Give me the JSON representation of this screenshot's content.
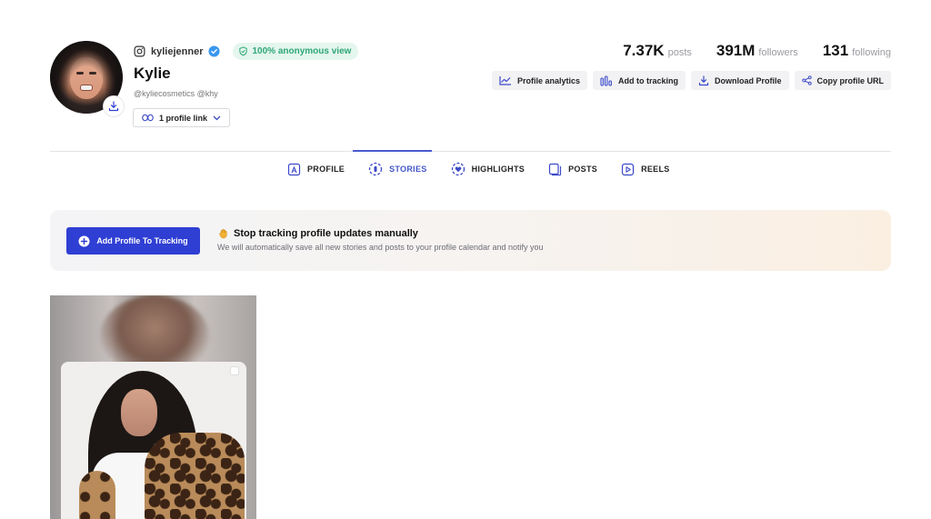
{
  "profile": {
    "handle": "kyliejenner",
    "name": "Kylie",
    "aliases": "@kyliecosmetics @khy",
    "anonymous_badge": "100% anonymous view",
    "profile_link_label": "1 profile link"
  },
  "stats": [
    {
      "value": "7.37K",
      "label": "posts"
    },
    {
      "value": "391M",
      "label": "followers"
    },
    {
      "value": "131",
      "label": "following"
    }
  ],
  "actions": {
    "analytics": "Profile analytics",
    "tracking": "Add to tracking",
    "download": "Download Profile",
    "copy_url": "Copy profile URL"
  },
  "tabs": {
    "profile": "PROFILE",
    "stories": "STORIES",
    "highlights": "HIGHLIGHTS",
    "posts": "POSTS",
    "reels": "REELS",
    "active": "stories"
  },
  "banner": {
    "cta_label": "Add Profile To Tracking",
    "title": "Stop tracking profile updates manually",
    "subtitle": "We will automatically save all new stories and posts to your profile calendar and notify you"
  },
  "colors": {
    "accent": "#2f3fd3",
    "tab_active": "#4356c8",
    "badge_green": "#2fa77a",
    "verified_blue": "#3897f0"
  },
  "icons": {
    "instagram": "instagram-icon",
    "verified": "verified-badge-icon",
    "shield": "shield-check-icon",
    "link": "link-icon",
    "chevron": "chevron-down-icon",
    "download": "download-icon",
    "analytics": "line-chart-icon",
    "tracking": "bar-chart-icon",
    "share": "share-icon",
    "plus": "plus-circle-icon",
    "hand": "raised-hand-icon"
  }
}
